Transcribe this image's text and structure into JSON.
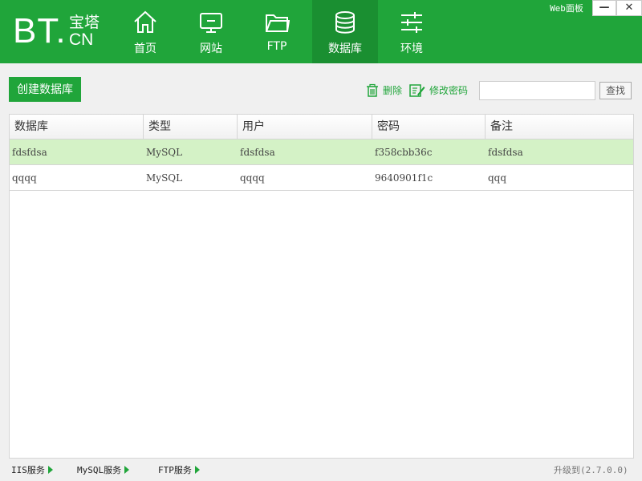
{
  "brand": {
    "bt": "BT.",
    "cn_top": "宝塔",
    "cn_bot": "CN"
  },
  "nav": [
    {
      "label": "首页",
      "icon": "home-icon"
    },
    {
      "label": "网站",
      "icon": "monitor-icon"
    },
    {
      "label": "FTP",
      "icon": "folder-icon"
    },
    {
      "label": "数据库",
      "icon": "database-icon",
      "active": true
    },
    {
      "label": "环境",
      "icon": "sliders-icon"
    }
  ],
  "window": {
    "web_panel": "Web面板",
    "minimize": "—",
    "close": "✕"
  },
  "toolbar": {
    "create_label": "创建数据库",
    "delete_label": "删除",
    "edit_password_label": "修改密码",
    "search_value": "",
    "search_button": "查找"
  },
  "table": {
    "headers": [
      "数据库",
      "类型",
      "用户",
      "密码",
      "备注"
    ],
    "rows": [
      {
        "db": "fdsfdsa",
        "type": "MySQL",
        "user": "fdsfdsa",
        "password": "f358cbb36c",
        "note": "fdsfdsa",
        "selected": true
      },
      {
        "db": "qqqq",
        "type": "MySQL",
        "user": "qqqq",
        "password": "9640901f1c",
        "note": "qqq",
        "selected": false
      }
    ]
  },
  "statusbar": {
    "services": [
      "IIS服务",
      "MySQL服务",
      "FTP服务"
    ],
    "upgrade": "升级到(2.7.0.0)"
  },
  "colors": {
    "brand_green": "#20a53a",
    "active_nav": "#1a8f31",
    "selected_row": "#d4f2c6"
  }
}
